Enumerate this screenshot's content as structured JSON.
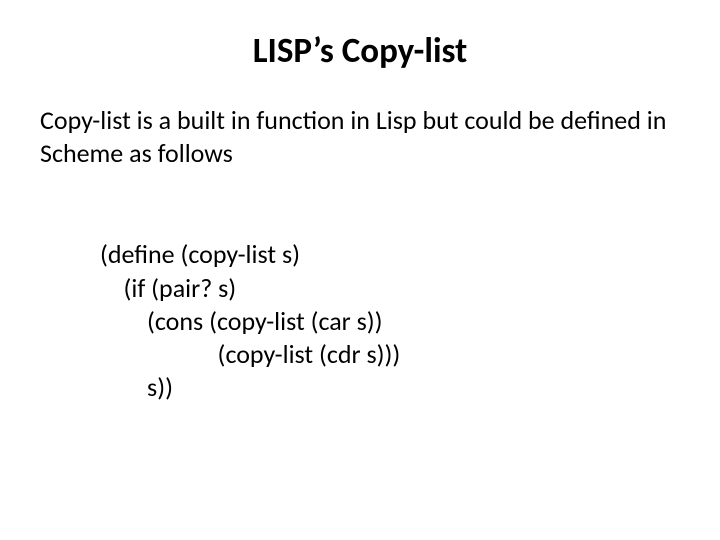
{
  "title": "LISP’s Copy-list",
  "paragraph": "Copy-list is a built in function in Lisp but could be defined in Scheme as follows",
  "code": {
    "l1": "(define (copy-list s)",
    "l2": "    (if (pair? s)",
    "l3": "        (cons (copy-list (car s))",
    "l4": "                    (copy-list (cdr s)))",
    "l5": "        s))"
  }
}
